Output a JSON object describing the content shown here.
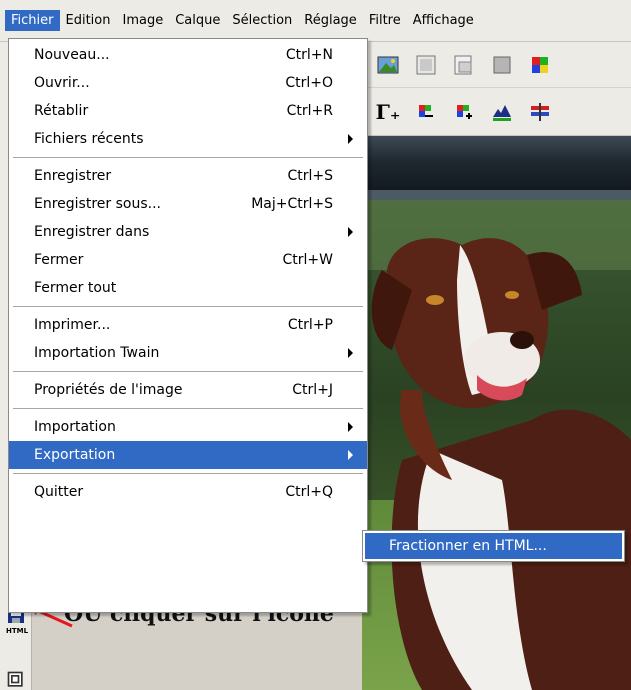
{
  "menubar": {
    "items": [
      "Fichier",
      "Edition",
      "Image",
      "Calque",
      "Sélection",
      "Réglage",
      "Filtre",
      "Affichage"
    ],
    "active_index": 0
  },
  "file_menu": {
    "groups": [
      [
        {
          "label": "Nouveau...",
          "shortcut": "Ctrl+N",
          "submenu": false
        },
        {
          "label": "Ouvrir...",
          "shortcut": "Ctrl+O",
          "submenu": false
        },
        {
          "label": "Rétablir",
          "shortcut": "Ctrl+R",
          "submenu": false
        },
        {
          "label": "Fichiers récents",
          "shortcut": "",
          "submenu": true
        }
      ],
      [
        {
          "label": "Enregistrer",
          "shortcut": "Ctrl+S",
          "submenu": false
        },
        {
          "label": "Enregistrer sous...",
          "shortcut": "Maj+Ctrl+S",
          "submenu": false
        },
        {
          "label": "Enregistrer dans",
          "shortcut": "",
          "submenu": true
        },
        {
          "label": "Fermer",
          "shortcut": "Ctrl+W",
          "submenu": false
        },
        {
          "label": "Fermer tout",
          "shortcut": "",
          "submenu": false
        }
      ],
      [
        {
          "label": "Imprimer...",
          "shortcut": "Ctrl+P",
          "submenu": false
        },
        {
          "label": "Importation Twain",
          "shortcut": "",
          "submenu": true
        }
      ],
      [
        {
          "label": "Propriétés de l'image",
          "shortcut": "Ctrl+J",
          "submenu": false
        }
      ],
      [
        {
          "label": "Importation",
          "shortcut": "",
          "submenu": true
        },
        {
          "label": "Exportation",
          "shortcut": "",
          "submenu": true,
          "highlighted": true
        }
      ],
      [
        {
          "label": "Quitter",
          "shortcut": "Ctrl+Q",
          "submenu": false
        }
      ]
    ]
  },
  "export_submenu": {
    "items": [
      "Fractionner en HTML..."
    ]
  },
  "annotation": {
    "text": "OU cliquer sur l'icone",
    "arrow_color": "#e8151b"
  },
  "toolbar": {
    "icons": [
      "image-landscape-icon",
      "image-grid-icon",
      "image-export-icon",
      "gray-square-icon",
      "color-palette-icon",
      "gamma-icon",
      "color-levels-icon",
      "color-plus-icon",
      "histogram-icon",
      "adjust-bars-icon"
    ],
    "gamma_glyph": "Γ₊"
  },
  "colors": {
    "menu_highlight": "#316ac5",
    "menubar_bg": "#ecebe6"
  }
}
